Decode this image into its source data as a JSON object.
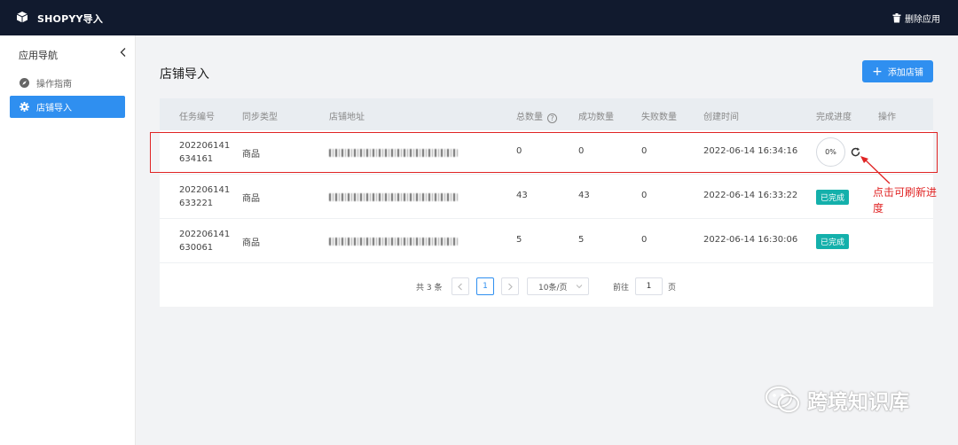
{
  "header": {
    "app_title": "SHOPYY导入",
    "delete_label": "删除应用"
  },
  "sidebar": {
    "title": "应用导航",
    "items": [
      {
        "label": "操作指南",
        "icon": "compass-icon",
        "active": false
      },
      {
        "label": "店铺导入",
        "icon": "gear-icon",
        "active": true
      }
    ]
  },
  "main": {
    "page_title": "店铺导入",
    "add_button": "添加店铺"
  },
  "table": {
    "columns": [
      "任务编号",
      "同步类型",
      "店铺地址",
      "总数量",
      "成功数量",
      "失败数量",
      "创建时间",
      "完成进度",
      "操作"
    ],
    "rows": [
      {
        "id_line1": "202206141",
        "id_line2": "634161",
        "type": "商品",
        "total": "0",
        "success": "0",
        "failed": "0",
        "created": "2022-06-14 16:34:16",
        "progress": "0%"
      },
      {
        "id_line1": "202206141",
        "id_line2": "633221",
        "type": "商品",
        "total": "43",
        "success": "43",
        "failed": "0",
        "created": "2022-06-14 16:33:22",
        "status": "已完成"
      },
      {
        "id_line1": "202206141",
        "id_line2": "630061",
        "type": "商品",
        "total": "5",
        "success": "5",
        "failed": "0",
        "created": "2022-06-14 16:30:06",
        "status": "已完成"
      }
    ]
  },
  "pagination": {
    "total_text": "共 3 条",
    "current_page": "1",
    "page_size": "10条/页",
    "goto_label": "前往",
    "goto_value": "1",
    "page_suffix": "页"
  },
  "annotation": {
    "text": "点击可刷新进度"
  },
  "watermark": {
    "text": "跨境知识库"
  },
  "colors": {
    "topbar": "#111a2e",
    "primary": "#2f8ff0",
    "success_badge": "#14b0ab",
    "annotation_red": "#e02424"
  }
}
